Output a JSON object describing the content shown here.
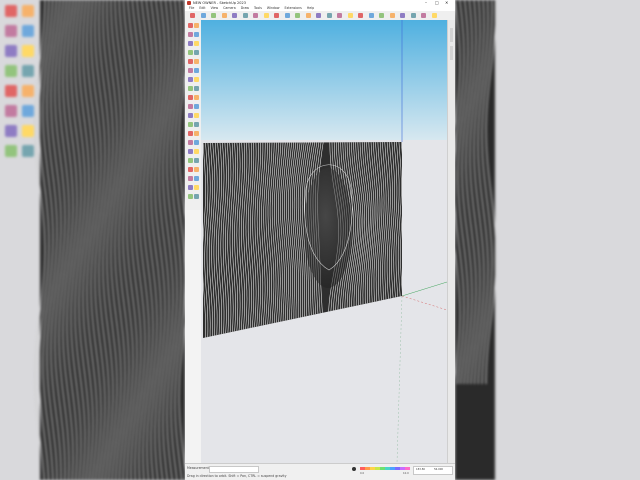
{
  "window": {
    "title": "NEW OWNER - SketchUp 2023",
    "minimize": "–",
    "maximize": "□",
    "close": "✕"
  },
  "menu": [
    "File",
    "Edit",
    "View",
    "Camera",
    "Draw",
    "Tools",
    "Window",
    "Extensions",
    "Help"
  ],
  "icons": {
    "toolbar": [
      "select-icon",
      "eraser-icon",
      "line-icon",
      "arc-icon",
      "rectangle-icon",
      "circle-icon",
      "push-pull-icon",
      "move-icon",
      "rotate-icon",
      "scale-icon",
      "offset-icon",
      "tape-measure-icon",
      "dimension-icon",
      "protractor-icon",
      "text-icon",
      "axes-icon",
      "3d-text-icon",
      "orbit-icon",
      "pan-icon",
      "zoom-icon",
      "zoom-extents-icon",
      "warehouse-icon",
      "extension-warehouse-icon",
      "layout-icon"
    ],
    "left_tools_count": 40
  },
  "colors": {
    "sky_top": "#4fb0e0",
    "sky_bottom": "#d7e8f0",
    "ground": "#e4e5e9",
    "model_fill": "#2e2e2e",
    "model_lines": "#f2f2f2",
    "axis_red": "#d24a4a",
    "axis_green": "#3fa45a",
    "axis_blue": "#3f6bd8"
  },
  "status": {
    "measurements_label": "Measurements",
    "text": "Drag in direction to orbit. Shift = Pan, CTRL = suspend gravity",
    "scale_left": "0.0",
    "scale_right": "10.0",
    "box_a": "183.80",
    "box_b": "56.000"
  }
}
